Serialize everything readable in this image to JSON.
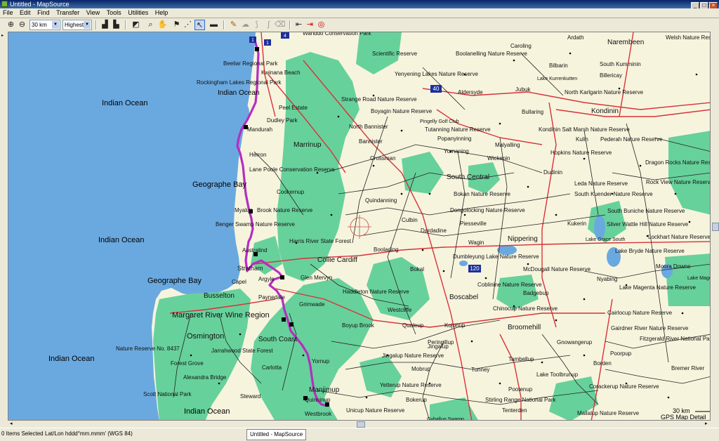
{
  "window": {
    "title": "Untitled - MapSource"
  },
  "menu": {
    "items": [
      "File",
      "Edit",
      "Find",
      "Transfer",
      "View",
      "Tools",
      "Utilities",
      "Help"
    ]
  },
  "toolbar": {
    "zoom_value": "30 km",
    "detail_value": "Highest"
  },
  "map": {
    "scale_label": "30 km",
    "detail_label": "GPS Map Detail",
    "colors": {
      "ocean": "#6aa9e0",
      "land": "#f7f4dd",
      "forest": "#67d19b",
      "route": "#b52ec1",
      "highway": "#d8323b",
      "road": "#222222",
      "town": "#000000"
    },
    "labels": {
      "ocean": [
        "Indian Ocean",
        "Indian Ocean",
        "Indian Ocean",
        "Indian Ocean",
        "Indian Ocean"
      ],
      "bays": [
        "Geographe Bay",
        "Geographe Bay"
      ],
      "places": [
        "Wanddo Conservation Park",
        "Scientific Reserve",
        "Boolanelling Nature Reserve",
        "Caroling",
        "Ardath",
        "Narembeen",
        "Welsh Nature Res",
        "Beeliar Regional Park",
        "Kwinana Beach",
        "Rockingham Lakes Regional Park",
        "Yenyening Lakes Nature Reserve",
        "Bilbarin",
        "South Kumminin",
        "Lake Kurrenkutten",
        "Billericay",
        "Aldersyde",
        "Jubuk",
        "North Karlgarin Nature Reserve",
        "Strange Road Nature Reserve",
        "Peel Estate",
        "Boyagin Nature Reserve",
        "Bullaring",
        "Kondinin",
        "Dudley Park",
        "Pingelly Golf Club",
        "Tutanning Nature Reserve",
        "North Bannister",
        "Kondinin Salt Marsh Nature Reserve",
        "Mandurah",
        "Popanyinning",
        "Kulin",
        "Pederah Nature Reserve",
        "Bannister",
        "Malyalling",
        "Marrinup",
        "Yornaning",
        "Hopkins Nature Reserve",
        "Herron",
        "Crossman",
        "Wickepin",
        "Dragon Rocks Nature Reserve",
        "Lane Poole Conservation Reserve",
        "Dudinin",
        "South Central",
        "Leda Nature Reserve",
        "Rock View Nature Reserve",
        "Cookernup",
        "Bokan Nature Reserve",
        "South Kuender Nature Reserve",
        "Quindanning",
        "Dongolocking Nature Reserve",
        "South Buniche Nature Reserve",
        "Myalup",
        "Brook Nature Reserve",
        "Culbin",
        "Kukerin",
        "Silver Wattle Hill Nature Reserve",
        "Benger Swamp Nature Reserve",
        "Dardadine",
        "Piesseville",
        "Nippering",
        "Lockhart Nature Reserve",
        "Harris River State Forest",
        "Wagin",
        "Lake Grace South",
        "Australind",
        "Boolading",
        "Dumbleyung Lake Nature Reserve",
        "Lake Bryde Nature Reserve",
        "Collie Cardiff",
        "Bokal",
        "Moora Downs",
        "Stratham",
        "McDougall Nature Reserve",
        "Argyle",
        "Glen Mervyn",
        "Nyabing",
        "Lake Magenta Nature Reserve",
        "Capel",
        "Haddleton Nature Reserve",
        "Coblinine Nature Reserve",
        "Lake Magenta",
        "Busselton",
        "Boscabel",
        "Badgebup",
        "Paynedale",
        "Grimwade",
        "Margaret River Wine Region",
        "Westcliffe",
        "Cairlocup Nature Reserve",
        "Chinocup Nature Reserve",
        "Boyup Brook",
        "Qualeup",
        "Kojonup",
        "Broomehill",
        "Gairdner River Nature Reserve",
        "Osmington",
        "South Coast",
        "Jingalup",
        "Peringillup",
        "Gnowangerup",
        "Fitzgerald River National Park",
        "Nature Reserve No. 8437",
        "Jarrahwood State Forest",
        "Jingalup Nature Reserve",
        "Tambellup",
        "Poorpup",
        "Yornup",
        "Forest Grove",
        "Carlotta",
        "Mobrup",
        "Tunney",
        "Lake Toolbrunup",
        "Borden",
        "Bremer River",
        "Alexandra Bridge",
        "Yetterup Nature Reserve",
        "Pootenup",
        "Corackerup Nature Reserve",
        "Scott National Park",
        "Steward",
        "Manjimup",
        "Bokerup",
        "Stirling Range National Park",
        "Quinninup",
        "Unicup Nature Reserve",
        "Tenterden",
        "Mailalup Nature Reserve",
        "Westbrook",
        "Gyballup Swamp"
      ]
    },
    "shields": [
      "1",
      "4",
      "40",
      "120"
    ]
  },
  "status": {
    "selection": "0 Items Selected",
    "coords": "Lat/Lon hddd°mm.mmm' (WGS 84)",
    "taskbar_item": "Untitled - MapSource"
  }
}
